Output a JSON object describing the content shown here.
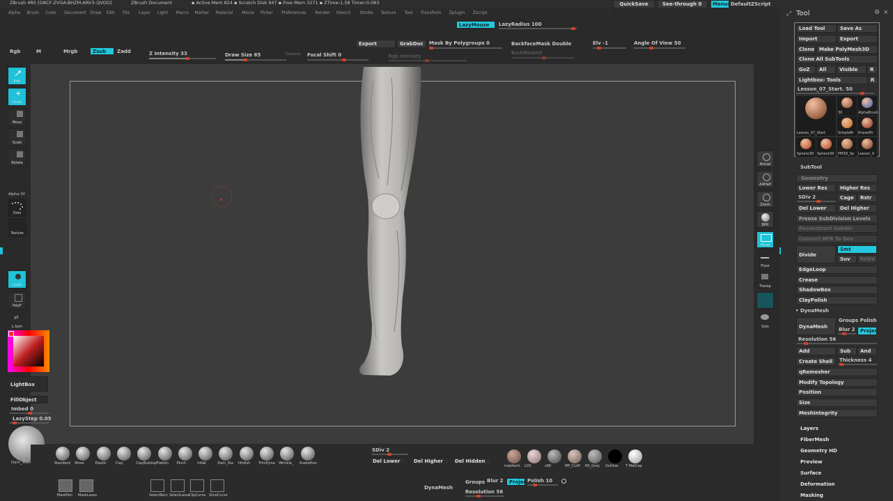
{
  "title_bar": {
    "app": "ZBrush 4R5 [G8CF-ZVGA-BHZM-ARV3-QVOD]",
    "doc": "ZBrush Document",
    "mem": "▪ Active Mem 824 ▪ Scratch Disk 947 ▪ Free Mem 3271 ▪ ZTime›1.58 Timer›0.083",
    "quicksave": "QuickSave",
    "seethrough": "See-through 0",
    "menus": "Menus",
    "script": "DefaultZScript"
  },
  "menu": [
    "Alpha",
    "Brush",
    "Color",
    "Document",
    "Draw",
    "Edit",
    "File",
    "Layer",
    "Light",
    "Macro",
    "Marker",
    "Material",
    "Movie",
    "Picker",
    "Preferences",
    "Render",
    "Stencil",
    "Stroke",
    "Texture",
    "Tool",
    "Transform",
    "Zplugin",
    "Zscript"
  ],
  "toolbar": {
    "lazymouse": "LazyMouse",
    "lazyradius": "LazyRadius 100",
    "export": "Export",
    "grabdoc": "GrabDoc",
    "mask_polygroups": "Mask By Polygroups 0",
    "backface": "BackfaceMask Double",
    "elv": "Elv -1",
    "angle": "Angle Of View 50",
    "backmaskint": "BackMaskInt",
    "rgb": "Rgb",
    "m": "M",
    "mrgb": "Mrgb",
    "zsub": "Zsub",
    "zadd": "Zadd",
    "zintensity": "Z Intensity 33",
    "drawsize": "Draw Size 65",
    "dynamic": "Dynamic",
    "focal": "Focal Shift 0",
    "rgbintensity": "Rgb Intensity"
  },
  "left_tools": {
    "edit": "Edit",
    "draw": "Draw",
    "move": "Move",
    "scale": "Scale",
    "rotate": "Rotate",
    "alpha": "Alpha Of",
    "dots": "Dots",
    "texture": "Texture",
    "local": "Local",
    "polyf": "PolyF",
    "lsym": "L.Sym",
    "lightbox": "LightBox",
    "fillobject": "FillObject",
    "imbed": "Imbed 0",
    "lazystep": "LazyStep 0.05",
    "brushname": "Dam_Standard"
  },
  "right_tools": [
    "Actual",
    "AAHalf",
    "Zoom",
    "BPR",
    "Persp",
    "Floor",
    "Transp",
    "Solo"
  ],
  "bottom": {
    "brushes": [
      "Standard",
      "Move",
      "Elastic",
      "Clay",
      "ClayBuildup",
      "Flatten",
      "Pinch",
      "Inflat",
      "Dam_Sta",
      "hPolish",
      "TrimDyna",
      "Wrinkle_",
      "SnakeHoo"
    ],
    "sdiv": "SDiv 2",
    "del_lower": "Del Lower",
    "del_higher": "Del Higher",
    "del_hidden": "Del Hidden",
    "materials": [
      "matAeml",
      "L03",
      "z98",
      "MP_CLAY",
      "RS_Grey",
      "Outline",
      "T MatCap"
    ],
    "dynamesh": "DynaMesh",
    "groups": "Groups",
    "blur": "Blur 2",
    "project": "Project",
    "polish": "Polish 10",
    "resolution": "Resolution 56",
    "bottom_tools": [
      "MaskPen",
      "MaskLasso",
      "SelectRect",
      "SelectLasso",
      "ClipCurve",
      "SliceCurve"
    ]
  },
  "tool_panel": {
    "title": "Tool",
    "load": "Load Tool",
    "save": "Save As",
    "import": "Import",
    "export": "Export",
    "clone": "Clone",
    "make_poly": "Make PolyMesh3D",
    "clone_all": "Clone All SubTools",
    "goz": "GoZ",
    "all": "All",
    "visible": "Visible",
    "r": "R",
    "lightbox_tools": "Lightbox› Tools",
    "current": "Lesson_07_Start. 50",
    "thumbs": [
      "Lesson_07_Start",
      "30",
      "AlphaBrush",
      "SimpleBr",
      "EraserBr",
      "Sphere3D",
      "Sphere3D",
      "PM3D_Sp",
      "Lesson_0"
    ],
    "subtool": "SubTool",
    "geometry": "Geometry",
    "lower_res": "Lower Res",
    "higher_res": "Higher Res",
    "sdiv": "SDiv 2",
    "cage": "Cage",
    "rstr": "Rstr",
    "del_lower": "Del Lower",
    "del_higher": "Del Higher",
    "freeze": "Freeze SubDivision Levels",
    "reconstruct": "Reconstruct Subdiv",
    "convert": "Convert BPR To Geo",
    "divide": "Divide",
    "smt": "Smt",
    "suv": "Suv",
    "reuv": "ReUV",
    "edgeloop": "EdgeLoop",
    "crease": "Crease",
    "shadowbox": "ShadowBox",
    "claypolish": "ClayPolish",
    "dynamesh_h": "• DynaMesh",
    "dynamesh": "DynaMesh",
    "groups_polish": "Groups Polish",
    "blur": "Blur 2",
    "project": "Project",
    "resolution": "Resolution 56",
    "add": "Add",
    "sub": "Sub",
    "and": "And",
    "create_shell": "Create Shell",
    "thickness": "Thickness 4",
    "qremesher": "qRemesher",
    "modify_topology": "Modify Topology",
    "position": "Position",
    "size": "Size",
    "meshintegrity": "MeshIntegrity",
    "sections": [
      "Layers",
      "FiberMesh",
      "Geometry HD",
      "Preview",
      "Surface",
      "Deformation",
      "Masking"
    ]
  }
}
